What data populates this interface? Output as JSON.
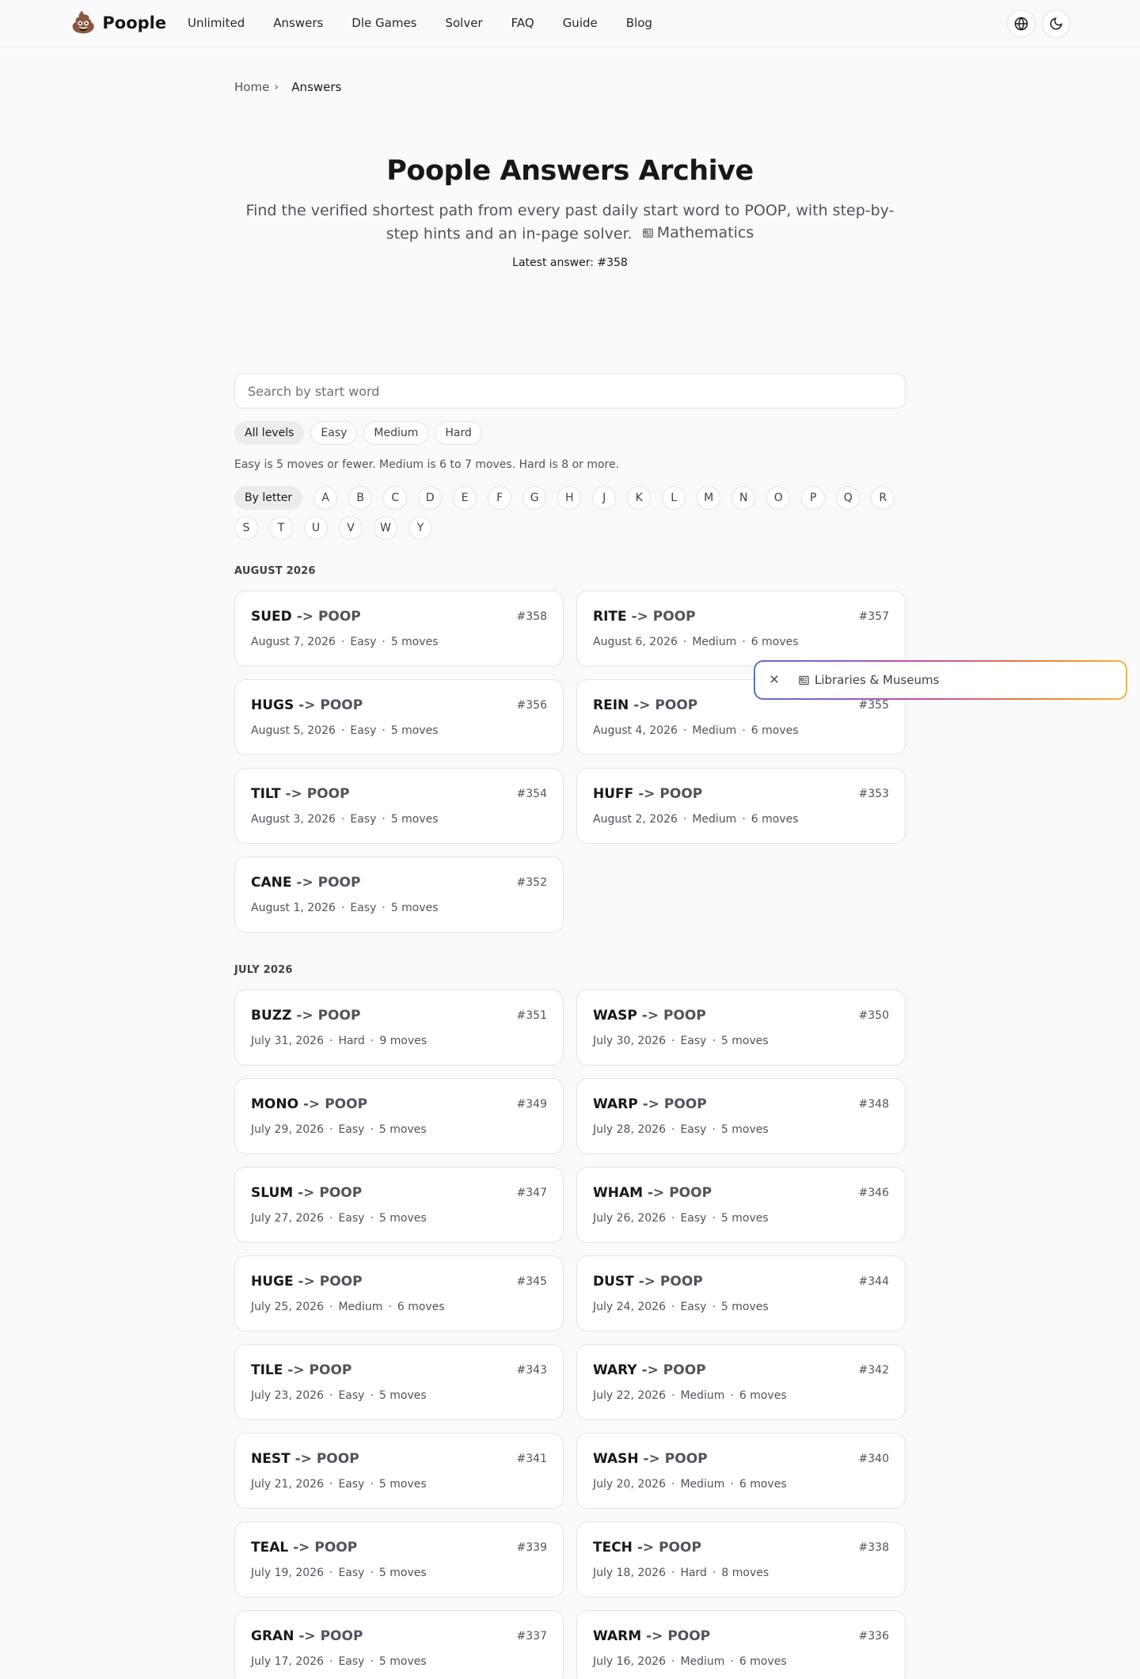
{
  "header": {
    "brand_icon": "💩",
    "brand_name": "Poople",
    "nav": [
      "Unlimited",
      "Answers",
      "Dle Games",
      "Solver",
      "FAQ",
      "Guide",
      "Blog"
    ],
    "icons": [
      "globe-icon",
      "moon-icon"
    ]
  },
  "breadcrumb": {
    "home": "Home",
    "current": "Answers"
  },
  "hero": {
    "title": "Poople Answers Archive",
    "subtitle": "Find the verified shortest path from every past daily start word to POOP, with step-by-step hints and an in-page solver.",
    "chip_label": "Mathematics",
    "latest": "Latest answer: #358"
  },
  "search": {
    "placeholder": "Search by start word",
    "value": ""
  },
  "levels": [
    "All levels",
    "Easy",
    "Medium",
    "Hard"
  ],
  "level_note": "Easy is 5 moves or fewer. Medium is 6 to 7 moves. Hard is 8 or more.",
  "letters": {
    "label": "By letter",
    "items": [
      "A",
      "B",
      "C",
      "D",
      "E",
      "F",
      "G",
      "H",
      "J",
      "K",
      "L",
      "M",
      "N",
      "O",
      "P",
      "Q",
      "R",
      "S",
      "T",
      "U",
      "V",
      "W",
      "Y"
    ]
  },
  "arrow": "->",
  "target": "POOP",
  "months": [
    {
      "label": "AUGUST 2026",
      "cards": [
        {
          "start": "SUED",
          "num": "#358",
          "date": "August 7, 2026",
          "level": "Easy",
          "moves": "5 moves"
        },
        {
          "start": "RITE",
          "num": "#357",
          "date": "August 6, 2026",
          "level": "Medium",
          "moves": "6 moves"
        },
        {
          "start": "HUGS",
          "num": "#356",
          "date": "August 5, 2026",
          "level": "Easy",
          "moves": "5 moves"
        },
        {
          "start": "REIN",
          "num": "#355",
          "date": "August 4, 2026",
          "level": "Medium",
          "moves": "6 moves"
        },
        {
          "start": "TILT",
          "num": "#354",
          "date": "August 3, 2026",
          "level": "Easy",
          "moves": "5 moves"
        },
        {
          "start": "HUFF",
          "num": "#353",
          "date": "August 2, 2026",
          "level": "Medium",
          "moves": "6 moves"
        },
        {
          "start": "CANE",
          "num": "#352",
          "date": "August 1, 2026",
          "level": "Easy",
          "moves": "5 moves"
        }
      ]
    },
    {
      "label": "JULY 2026",
      "cards": [
        {
          "start": "BUZZ",
          "num": "#351",
          "date": "July 31, 2026",
          "level": "Hard",
          "moves": "9 moves"
        },
        {
          "start": "WASP",
          "num": "#350",
          "date": "July 30, 2026",
          "level": "Easy",
          "moves": "5 moves"
        },
        {
          "start": "MONO",
          "num": "#349",
          "date": "July 29, 2026",
          "level": "Easy",
          "moves": "5 moves"
        },
        {
          "start": "WARP",
          "num": "#348",
          "date": "July 28, 2026",
          "level": "Easy",
          "moves": "5 moves"
        },
        {
          "start": "SLUM",
          "num": "#347",
          "date": "July 27, 2026",
          "level": "Easy",
          "moves": "5 moves"
        },
        {
          "start": "WHAM",
          "num": "#346",
          "date": "July 26, 2026",
          "level": "Easy",
          "moves": "5 moves"
        },
        {
          "start": "HUGE",
          "num": "#345",
          "date": "July 25, 2026",
          "level": "Medium",
          "moves": "6 moves"
        },
        {
          "start": "DUST",
          "num": "#344",
          "date": "July 24, 2026",
          "level": "Easy",
          "moves": "5 moves"
        },
        {
          "start": "TILE",
          "num": "#343",
          "date": "July 23, 2026",
          "level": "Easy",
          "moves": "5 moves"
        },
        {
          "start": "WARY",
          "num": "#342",
          "date": "July 22, 2026",
          "level": "Medium",
          "moves": "6 moves"
        },
        {
          "start": "NEST",
          "num": "#341",
          "date": "July 21, 2026",
          "level": "Easy",
          "moves": "5 moves"
        },
        {
          "start": "WASH",
          "num": "#340",
          "date": "July 20, 2026",
          "level": "Medium",
          "moves": "6 moves"
        },
        {
          "start": "TEAL",
          "num": "#339",
          "date": "July 19, 2026",
          "level": "Easy",
          "moves": "5 moves"
        },
        {
          "start": "TECH",
          "num": "#338",
          "date": "July 18, 2026",
          "level": "Hard",
          "moves": "8 moves"
        },
        {
          "start": "GRAN",
          "num": "#337",
          "date": "July 17, 2026",
          "level": "Easy",
          "moves": "5 moves"
        },
        {
          "start": "WARM",
          "num": "#336",
          "date": "July 16, 2026",
          "level": "Medium",
          "moves": "6 moves"
        }
      ]
    }
  ],
  "popup": {
    "label": "Libraries & Museums",
    "icon": "newspaper-icon",
    "close_icon": "close-icon"
  }
}
